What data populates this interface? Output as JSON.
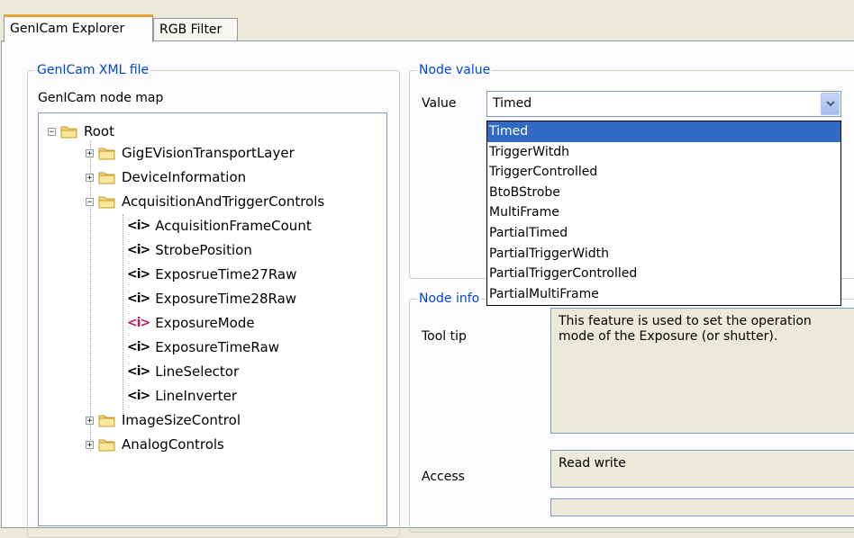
{
  "tabs": [
    {
      "label": "GenICam Explorer",
      "active": true
    },
    {
      "label": "RGB Filter",
      "active": false
    }
  ],
  "xml_group": {
    "legend": "GenICam XML file",
    "node_map_label": "GenICam node map"
  },
  "tree": {
    "root": "Root",
    "nodes": [
      {
        "label": "GigEVisionTransportLayer",
        "type": "folder",
        "expander": "+"
      },
      {
        "label": "DeviceInformation",
        "type": "folder",
        "expander": "+"
      },
      {
        "label": "AcquisitionAndTriggerControls",
        "type": "folder",
        "expander": "−"
      },
      {
        "label": "AcquisitionFrameCount",
        "type": "leaf",
        "icon": "<i>"
      },
      {
        "label": "StrobePosition",
        "type": "leaf",
        "icon": "<i>"
      },
      {
        "label": "ExposrueTime27Raw",
        "type": "leaf",
        "icon": "<i>"
      },
      {
        "label": "ExposureTime28Raw",
        "type": "leaf",
        "icon": "<i>"
      },
      {
        "label": "ExposureMode",
        "type": "leaf",
        "icon": "<i>",
        "highlight_color": "#c2185b"
      },
      {
        "label": "ExposureTimeRaw",
        "type": "leaf",
        "icon": "<i>"
      },
      {
        "label": "LineSelector",
        "type": "leaf",
        "icon": "<i>"
      },
      {
        "label": "LineInverter",
        "type": "leaf",
        "icon": "<i>"
      },
      {
        "label": "ImageSizeControl",
        "type": "folder",
        "expander": "+"
      },
      {
        "label": "AnalogControls",
        "type": "folder",
        "expander": "+"
      }
    ]
  },
  "node_value_group": {
    "legend": "Node value",
    "value_label": "Value",
    "selected_value": "Timed",
    "options": [
      "Timed",
      "TriggerWitdh",
      "TriggerControlled",
      "BtoBStrobe",
      "MultiFrame",
      "PartialTimed",
      "PartialTriggerWidth",
      "PartialTriggerControlled",
      "PartialMultiFrame"
    ]
  },
  "node_info_group": {
    "legend": "Node info",
    "tooltip_label": "Tool tip",
    "tooltip_text": "This feature is used to set the operation mode of the Exposure (or shutter).",
    "access_label": "Access",
    "access_value": "Read write"
  },
  "colors": {
    "legend_text": "#0046d5",
    "selection": "#316ac5",
    "tab_highlight": "#e6a23c",
    "window_bg": "#ece9d8"
  }
}
